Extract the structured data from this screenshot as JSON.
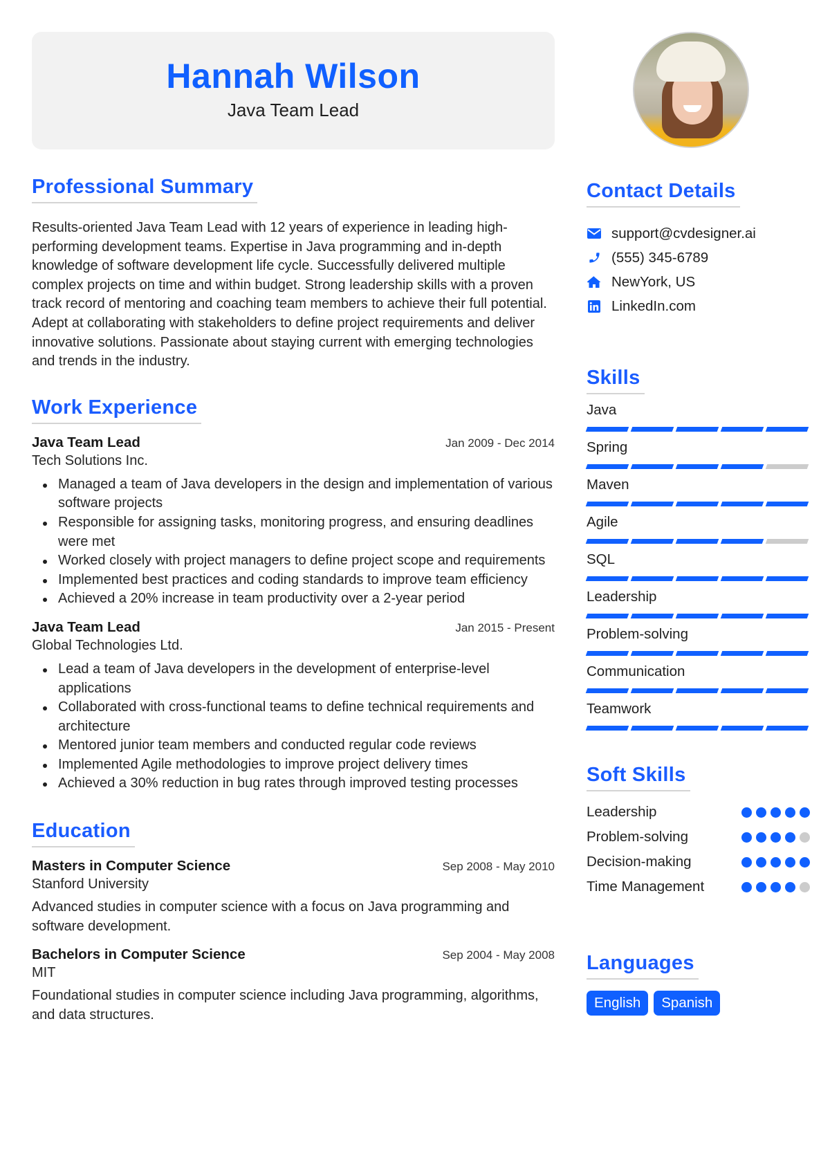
{
  "header": {
    "name": "Hannah Wilson",
    "title": "Java Team Lead"
  },
  "colors": {
    "accent": "#1060ff",
    "header_bg": "#f2f2f2",
    "inactive": "#cccccc"
  },
  "summary": {
    "heading": "Professional Summary",
    "text": "Results-oriented Java Team Lead with 12 years of experience in leading high-performing development teams. Expertise in Java programming and in-depth knowledge of software development life cycle. Successfully delivered multiple complex projects on time and within budget. Strong leadership skills with a proven track record of mentoring and coaching team members to achieve their full potential. Adept at collaborating with stakeholders to define project requirements and deliver innovative solutions. Passionate about staying current with emerging technologies and trends in the industry."
  },
  "experience": {
    "heading": "Work Experience",
    "jobs": [
      {
        "title": "Java Team Lead",
        "company": "Tech Solutions Inc.",
        "dates": "Jan 2009 - Dec 2014",
        "bullets": [
          "Managed a team of Java developers in the design and implementation of various software projects",
          "Responsible for assigning tasks, monitoring progress, and ensuring deadlines were met",
          "Worked closely with project managers to define project scope and requirements",
          "Implemented best practices and coding standards to improve team efficiency",
          "Achieved a 20% increase in team productivity over a 2-year period"
        ]
      },
      {
        "title": "Java Team Lead",
        "company": "Global Technologies Ltd.",
        "dates": "Jan 2015 - Present",
        "bullets": [
          "Lead a team of Java developers in the development of enterprise-level applications",
          "Collaborated with cross-functional teams to define technical requirements and architecture",
          "Mentored junior team members and conducted regular code reviews",
          "Implemented Agile methodologies to improve project delivery times",
          "Achieved a 30% reduction in bug rates through improved testing processes"
        ]
      }
    ]
  },
  "education": {
    "heading": "Education",
    "items": [
      {
        "degree": "Masters in Computer Science",
        "school": "Stanford University",
        "dates": "Sep 2008 - May 2010",
        "description": "Advanced studies in computer science with a focus on Java programming and software development."
      },
      {
        "degree": "Bachelors in Computer Science",
        "school": "MIT",
        "dates": "Sep 2004 - May 2008",
        "description": "Foundational studies in computer science including Java programming, algorithms, and data structures."
      }
    ]
  },
  "contact": {
    "heading": "Contact Details",
    "items": [
      {
        "icon": "envelope-icon",
        "text": "support@cvdesigner.ai"
      },
      {
        "icon": "phone-icon",
        "text": "(555) 345-6789"
      },
      {
        "icon": "home-icon",
        "text": "NewYork, US"
      },
      {
        "icon": "linkedin-icon",
        "text": "LinkedIn.com"
      }
    ]
  },
  "skills": {
    "heading": "Skills",
    "max": 5,
    "items": [
      {
        "name": "Java",
        "level": 5
      },
      {
        "name": "Spring",
        "level": 4
      },
      {
        "name": "Maven",
        "level": 5
      },
      {
        "name": "Agile",
        "level": 4
      },
      {
        "name": "SQL",
        "level": 5
      },
      {
        "name": "Leadership",
        "level": 5
      },
      {
        "name": "Problem-solving",
        "level": 5
      },
      {
        "name": "Communication",
        "level": 5
      },
      {
        "name": "Teamwork",
        "level": 5
      }
    ]
  },
  "soft_skills": {
    "heading": "Soft Skills",
    "max": 5,
    "items": [
      {
        "name": "Leadership",
        "level": 5
      },
      {
        "name": "Problem-solving",
        "level": 4
      },
      {
        "name": "Decision-making",
        "level": 5
      },
      {
        "name": "Time Management",
        "level": 4
      }
    ]
  },
  "languages": {
    "heading": "Languages",
    "items": [
      "English",
      "Spanish"
    ]
  }
}
